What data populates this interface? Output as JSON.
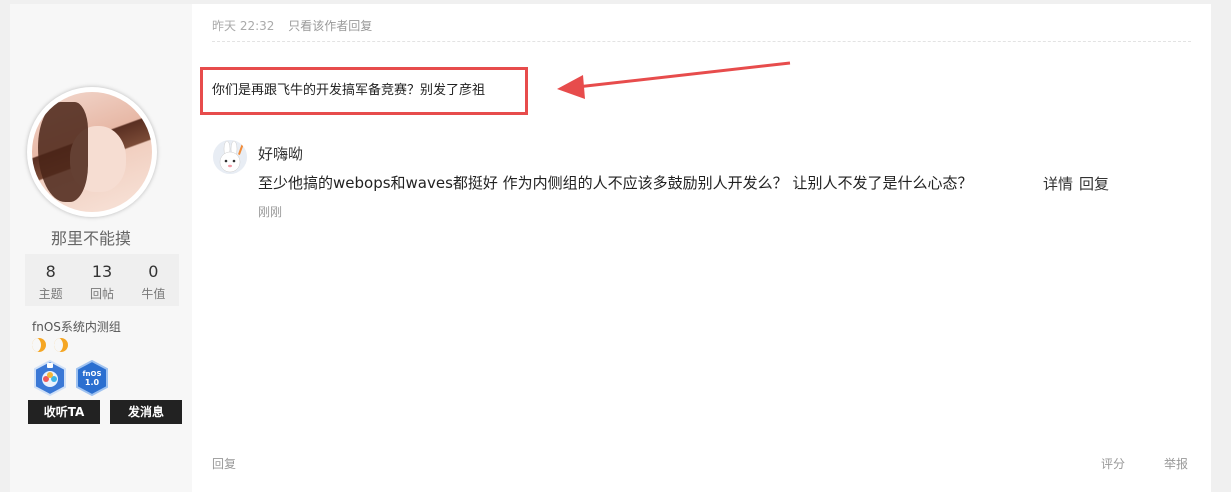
{
  "author": {
    "name": "那里不能摸",
    "stats": [
      {
        "value": "8",
        "label": "主题"
      },
      {
        "value": "13",
        "label": "回帖"
      },
      {
        "value": "0",
        "label": "牛值"
      }
    ],
    "group": "fnOS系统内测组",
    "badges": [
      {
        "icon": "tester-badge-icon"
      },
      {
        "icon": "fnos-1-0-badge-icon",
        "text_line1": "fnOS",
        "text_line2": "1.0"
      }
    ],
    "follow_label": "收听TA",
    "message_label": "发消息"
  },
  "post": {
    "time": "昨天 22:32",
    "author_only_label": "只看该作者",
    "reply_label": "回复",
    "content": "你们是再跟飞牛的开发搞军备竞赛？别发了彦祖",
    "annotation_color": "#e74c4c"
  },
  "comment": {
    "user": "好嗨呦",
    "text": "至少他搞的webops和waves都挺好 作为内侧组的人不应该多鼓励别人开发么？ 让别人不发了是什么心态？",
    "detail_label": "详情",
    "reply_label": "回复",
    "time": "刚刚"
  },
  "footer": {
    "reply_label": "回复",
    "rate_label": "评分",
    "report_label": "举报"
  }
}
